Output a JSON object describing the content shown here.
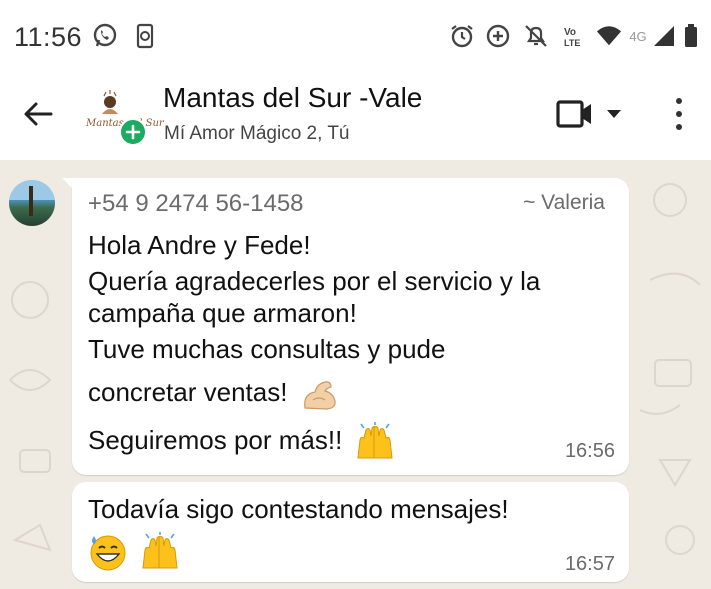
{
  "status_bar": {
    "time": "11:56",
    "network": "4G"
  },
  "header": {
    "title": "Mantas del Sur -Vale",
    "subtitle": "Mí Amor Mágico 2, Tú",
    "avatar_logo_text": "Mantas del Sur"
  },
  "messages": [
    {
      "sender_phone": "+54 9 2474 56-1458",
      "sender_name": "~ Valeria",
      "lines": [
        "Hola Andre y Fede!",
        "Quería agradecerles por el servicio y la",
        "campaña que armaron!",
        "Tuve muchas consultas y pude",
        "concretar ventas!",
        "Seguiremos por más!!"
      ],
      "emojis": [
        "flexed-biceps",
        "raising-hands"
      ],
      "time": "16:56"
    },
    {
      "lines": [
        "Todavía sigo contestando mensajes!"
      ],
      "emojis": [
        "grinning-face-with-sweat",
        "raising-hands"
      ],
      "time": "16:57"
    }
  ],
  "colors": {
    "chat_background": "#efeae2",
    "bubble": "#ffffff",
    "accent_green": "#1daa61"
  }
}
